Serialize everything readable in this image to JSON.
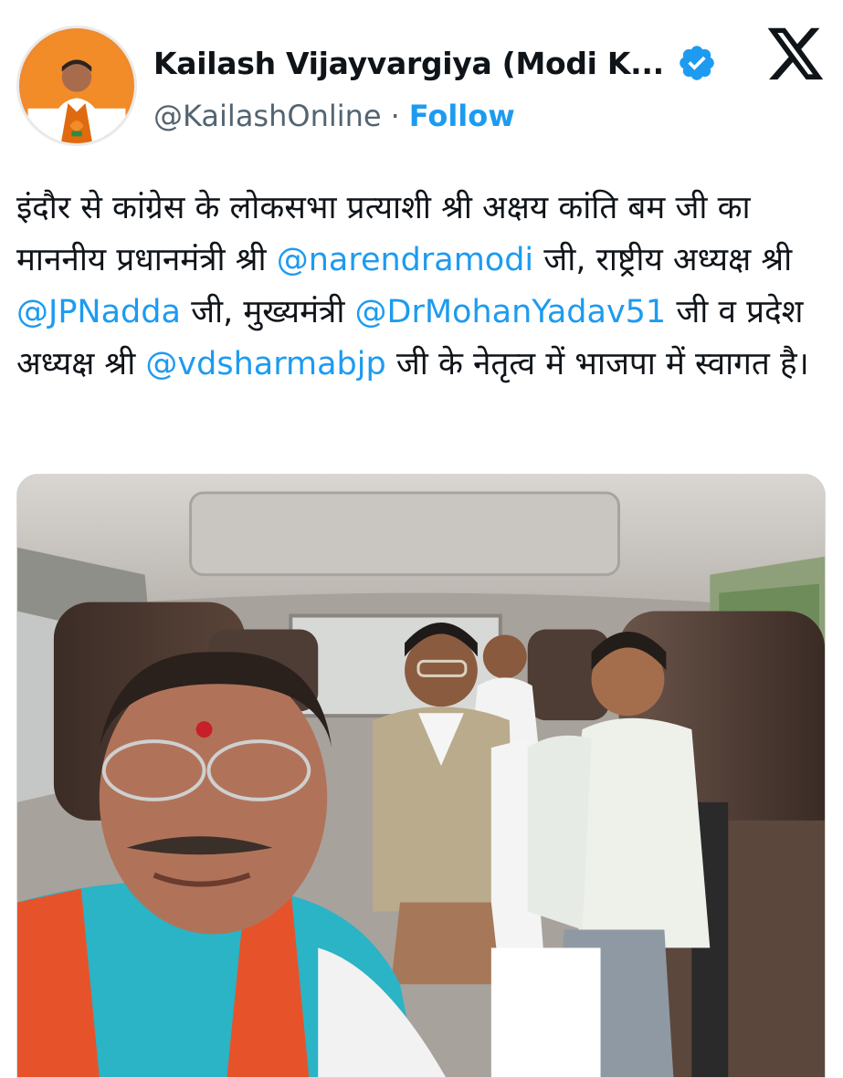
{
  "author": {
    "display_name": "Kailash Vijayvargiya (Modi K...",
    "handle": "@KailashOnline",
    "separator": "·",
    "follow_label": "Follow",
    "verified_icon": "verified-badge-icon",
    "platform_icon": "x-logo-icon"
  },
  "tweet": {
    "parts": [
      {
        "text": "इंदौर से कांग्रेस के लोकसभा प्रत्याशी श्री अक्षय कांति बम जी का माननीय प्रधानमंत्री श्री ",
        "mention": false
      },
      {
        "text": "@narendramodi",
        "mention": true
      },
      {
        "text": " जी, राष्ट्रीय अध्यक्ष श्री ",
        "mention": false
      },
      {
        "text": "@JPNadda",
        "mention": true
      },
      {
        "text": " जी, मुख्यमंत्री ",
        "mention": false
      },
      {
        "text": "@DrMohanYadav51",
        "mention": true
      },
      {
        "text": " जी व प्रदेश अध्यक्ष श्री ",
        "mention": false
      },
      {
        "text": "@vdsharmabjp",
        "mention": true
      },
      {
        "text": " जी के नेतृत्व में भाजपा में स्वागत है।",
        "mention": false
      }
    ]
  },
  "media": {
    "kind": "photo",
    "scene": "car-interior-selfie"
  },
  "colors": {
    "link": "#1d9bf0",
    "text": "#0f1419",
    "secondary": "#536471",
    "verified": "#1d9bf0"
  }
}
